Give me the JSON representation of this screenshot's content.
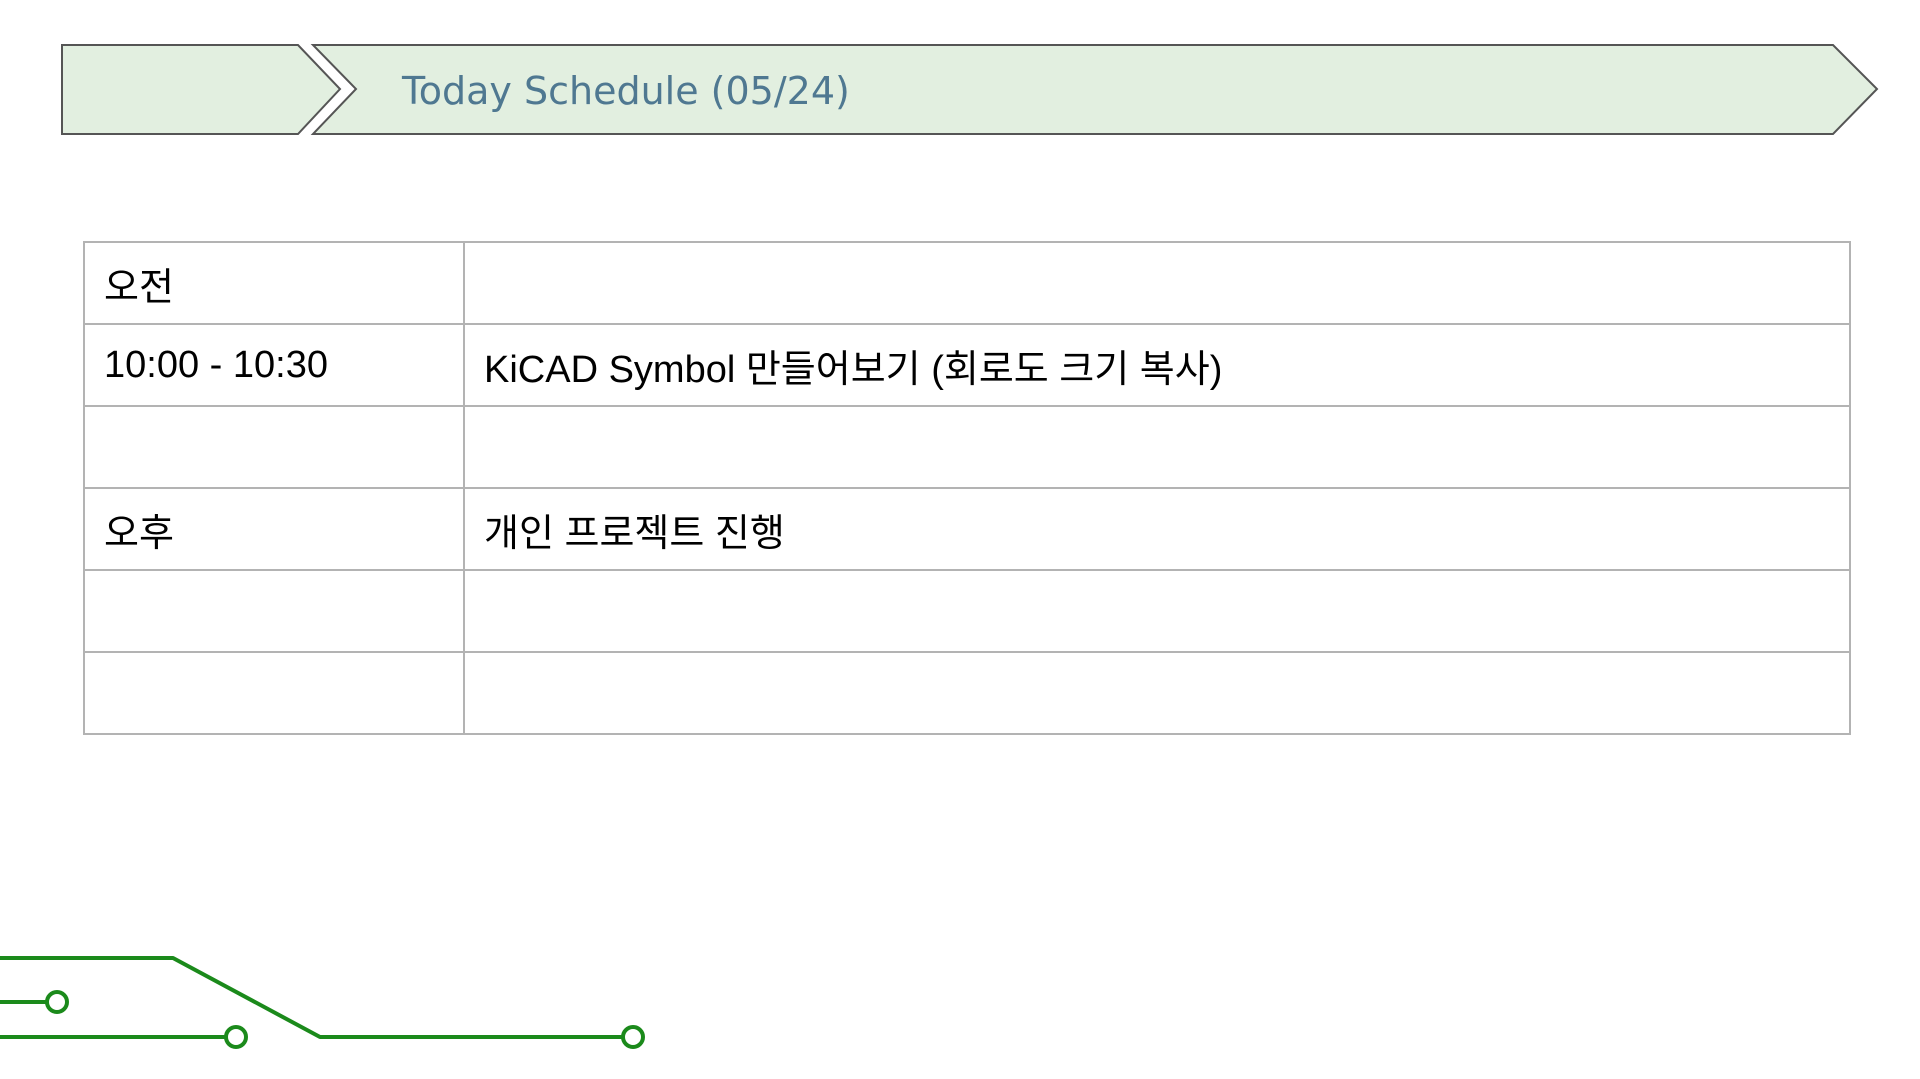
{
  "header": {
    "title": "Today Schedule (05/24)"
  },
  "schedule": {
    "rows": [
      {
        "time": "오전",
        "task": ""
      },
      {
        "time": "10:00 - 10:30",
        "task": "KiCAD  Symbol  만들어보기 (회로도 크기 복사)"
      },
      {
        "time": "",
        "task": ""
      },
      {
        "time": "오후",
        "task": "개인 프로젝트 진행"
      },
      {
        "time": "",
        "task": ""
      },
      {
        "time": "",
        "task": ""
      }
    ]
  },
  "colors": {
    "banner_fill": "#e2efe0",
    "banner_stroke": "#555555",
    "title_text": "#4f7891",
    "table_border": "#b3b3b3",
    "circuit_line": "#1b8a1b"
  }
}
